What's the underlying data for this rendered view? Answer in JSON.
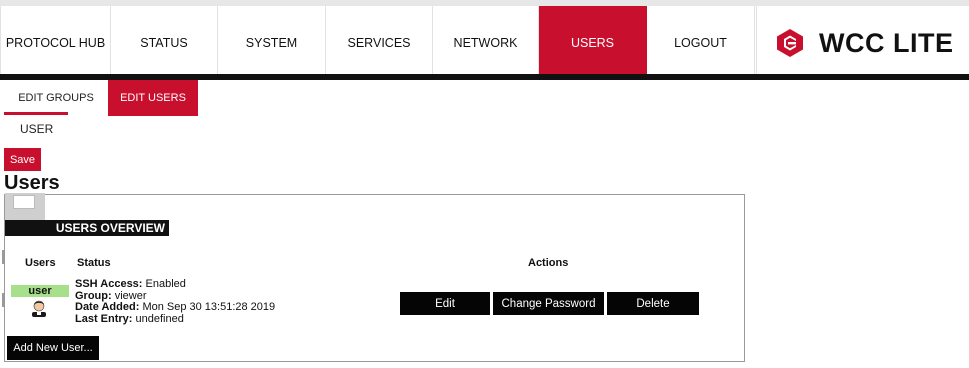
{
  "nav": {
    "items": [
      {
        "label": "PROTOCOL HUB",
        "active": false
      },
      {
        "label": "STATUS",
        "active": false
      },
      {
        "label": "SYSTEM",
        "active": false
      },
      {
        "label": "SERVICES",
        "active": false
      },
      {
        "label": "NETWORK",
        "active": false
      },
      {
        "label": "USERS",
        "active": true
      },
      {
        "label": "LOGOUT",
        "active": false
      }
    ],
    "logo_text": "WCC LITE",
    "logo_icon": "wcc-logo-icon"
  },
  "subnav": {
    "tabs": [
      {
        "label": "EDIT GROUPS",
        "active": false
      },
      {
        "label": "EDIT USERS",
        "active": true
      }
    ]
  },
  "breadcrumb": "USER",
  "save_label": "Save",
  "page_title": "Users",
  "panel": {
    "title": "USERS OVERVIEW",
    "columns": {
      "users": "Users",
      "status": "Status",
      "actions": "Actions"
    },
    "rows": [
      {
        "user_name": "user",
        "avatar_icon": "user-avatar-icon",
        "ssh_label": "SSH Access:",
        "ssh_value": "Enabled",
        "group_label": "Group:",
        "group_value": "viewer",
        "date_label": "Date Added:",
        "date_value": "Mon Sep 30 13:51:28 2019",
        "entry_label": "Last Entry:",
        "entry_value": "undefined",
        "actions": {
          "edit": "Edit",
          "change_password": "Change Password",
          "delete": "Delete"
        }
      }
    ],
    "add_label": "Add New User..."
  },
  "colors": {
    "accent": "#c8102e",
    "dark": "#050505",
    "badge": "#a6e08b"
  }
}
